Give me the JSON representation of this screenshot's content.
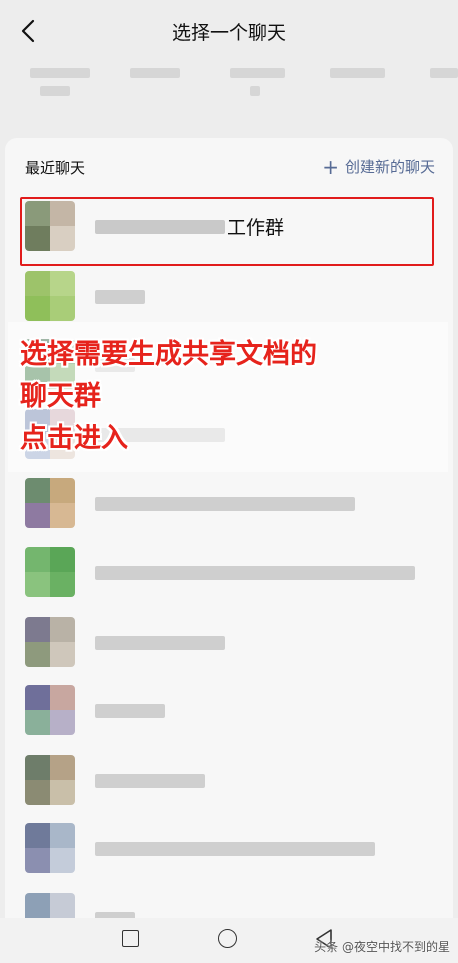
{
  "header": {
    "title": "选择一个聊天"
  },
  "section": {
    "recent_label": "最近聊天",
    "new_chat_label": "创建新的聊天"
  },
  "chats": [
    {
      "suffix": "工作群",
      "highlighted": true
    },
    {
      "suffix": ""
    },
    {
      "suffix": ""
    },
    {
      "suffix": ""
    },
    {
      "suffix": ""
    },
    {
      "suffix": ""
    },
    {
      "suffix": ""
    },
    {
      "suffix": ""
    },
    {
      "suffix": ""
    },
    {
      "suffix": ""
    },
    {
      "suffix": ""
    }
  ],
  "annotation": {
    "line1": "选择需要生成共享文档的",
    "line2": "聊天群",
    "line3": "点击进入",
    "color": "#e6231c"
  },
  "watermark": "头条 @夜空中找不到的星",
  "colors": {
    "link": "#576b95",
    "highlight": "#e11b1b"
  }
}
